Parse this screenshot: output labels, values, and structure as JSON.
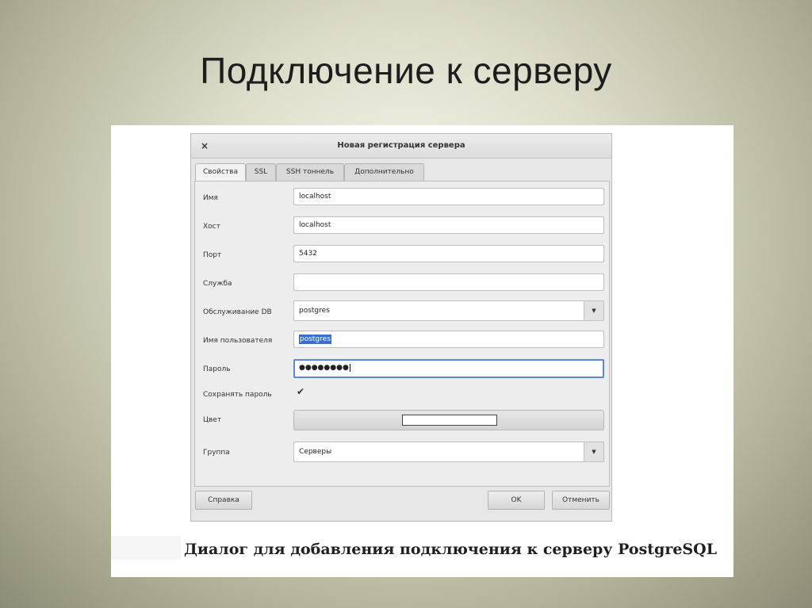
{
  "slide": {
    "title": "Подключение к серверу"
  },
  "dialog": {
    "close_glyph": "×",
    "title": "Новая регистрация сервера",
    "tabs": [
      "Свойства",
      "SSL",
      "SSH тоннель",
      "Дополнительно"
    ],
    "active_tab": "Свойства",
    "fields": {
      "name": {
        "label": "Имя",
        "value": "localhost"
      },
      "host": {
        "label": "Хост",
        "value": "localhost"
      },
      "port": {
        "label": "Порт",
        "value": "5432"
      },
      "service": {
        "label": "Служба",
        "value": ""
      },
      "maintenance_db": {
        "label": "Обслуживание DB",
        "value": "postgres"
      },
      "username": {
        "label": "Имя пользователя",
        "value": "postgres"
      },
      "password": {
        "label": "Пароль",
        "value": "●●●●●●●●"
      },
      "save_password": {
        "label": "Сохранять пароль",
        "checked": true,
        "glyph": "✔"
      },
      "color": {
        "label": "Цвет",
        "swatch": "#ffffff"
      },
      "group": {
        "label": "Группа",
        "value": "Серверы"
      }
    },
    "dropdown_glyph": "▼",
    "buttons": {
      "help": "Справка",
      "ok": "OK",
      "cancel": "Отменить"
    }
  },
  "caption": "Диалог для добавления подключения к серверу PostgreSQL",
  "colors": {
    "selection": "#3a6fc9",
    "focus_border": "#5b89d0"
  }
}
